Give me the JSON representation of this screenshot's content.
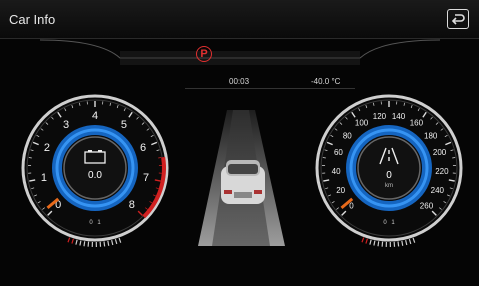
{
  "header": {
    "title": "Car Info",
    "back_icon": "back-icon"
  },
  "status": {
    "gear_indicator": "P",
    "trip_time": "00:03",
    "outside_temp": "-40.0 °C"
  },
  "tachometer": {
    "scale_labels": [
      "0",
      "1",
      "2",
      "3",
      "4",
      "5",
      "6",
      "7",
      "8"
    ],
    "value": "0.0",
    "icon": "battery-icon",
    "bottom_labels": [
      "0",
      "1"
    ]
  },
  "speedometer": {
    "scale_labels": [
      "0",
      "20",
      "40",
      "60",
      "80",
      "100",
      "120",
      "140",
      "160",
      "180",
      "200",
      "220",
      "240",
      "260"
    ],
    "value": "0",
    "unit": "km",
    "bottom_labels": [
      "0",
      "1"
    ]
  },
  "colors": {
    "accent_blue": "#1e7de0",
    "warning_red": "#d02020",
    "orange": "#e86a1a"
  }
}
